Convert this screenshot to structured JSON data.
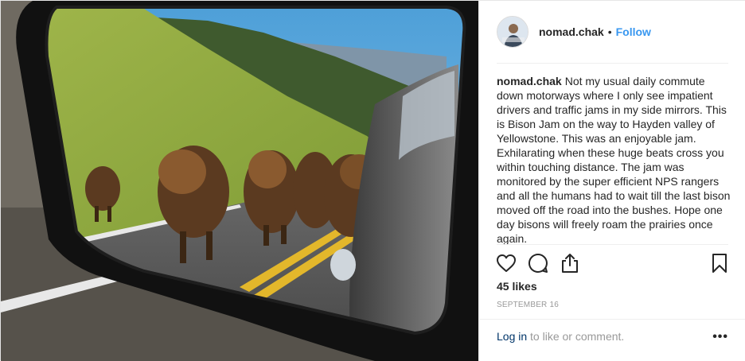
{
  "post": {
    "photo_description": "",
    "username": "nomad.chak",
    "separator": "•",
    "follow_label": "Follow",
    "caption_user": "nomad.chak",
    "caption_text": "Not my usual daily commute down motorways where I only see impatient drivers and traffic jams in my side mirrors. This is Bison Jam on the way to Hayden valley of Yellowstone. This was an enjoyable jam. Exhilarating when these huge beats cross you within touching distance. The jam was monitored by the super efficient NPS rangers and all the humans had to wait till the last bison moved off the road into the bushes. Hope one day bisons will freely roam the prairies once again.",
    "likes": "45 likes",
    "date": "September 16",
    "footer_login": "Log in",
    "footer_rest": " to like or comment.",
    "more_label": "•••"
  },
  "icons": {
    "like": "heart-icon",
    "comment": "comment-icon",
    "share": "share-icon",
    "save": "bookmark-icon"
  },
  "colors": {
    "link_blue": "#3897f0",
    "text": "#262626",
    "muted": "#999999",
    "login": "#003569"
  }
}
